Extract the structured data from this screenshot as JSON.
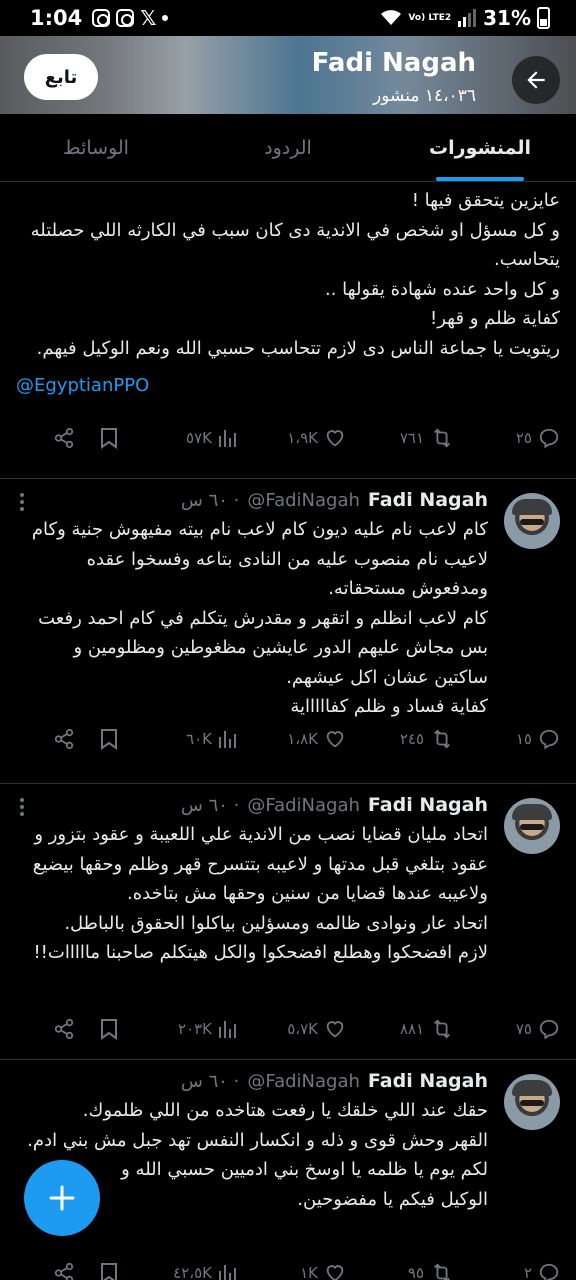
{
  "status_bar": {
    "time": "1:04",
    "lte_label": "Vo) LTE2",
    "battery": "31%"
  },
  "header": {
    "name": "Fadi Nagah",
    "posts_count": "١٤،٠٣٦ منشور",
    "follow_label": "تابع"
  },
  "tabs": [
    {
      "label": "المنشورات",
      "active": true
    },
    {
      "label": "الردود",
      "active": false
    },
    {
      "label": "الوسائط",
      "active": false
    }
  ],
  "posts": [
    {
      "text": "عايزين يتحقق فيها !\nو كل مسؤل او شخص في الاندية دى كان سبب في الكارثه اللي حصلتله يتحاسب.\nو كل واحد عنده شهادة يقولها ..\nكفاية ظلم و قهر!\nريتويت يا جماعة الناس دى لازم تتحاسب حسبي الله ونعم الوكيل فيهم.",
      "link": "@EgyptianPPO",
      "replies": "٢٥",
      "retweets": "٧٦١",
      "likes": "١،٩K",
      "views": "٥٧K"
    },
    {
      "name": "Fadi Nagah",
      "handle": "@FadiNagah",
      "time": "٦٠ س",
      "text": "كام لاعب نام عليه ديون كام لاعب نام بيته مفيهوش جنية وكام لاعيب نام منصوب عليه من النادى بتاعه وفسخوا عقده ومدفعوش مستحقاته.\nكام لاعب انظلم و اتقهر و مقدرش يتكلم في كام احمد رفعت بس مجاش عليهم الدور عايشين مظغوطين ومظلومين و ساكتين عشان اكل عيشهم.\nكفاية فساد و ظلم كفاااااية",
      "replies": "١٥",
      "retweets": "٢٤٥",
      "likes": "١،٨K",
      "views": "٦٠K"
    },
    {
      "name": "Fadi Nagah",
      "handle": "@FadiNagah",
      "time": "٦٠ س",
      "text": "اتحاد مليان قضايا نصب من الاندية علي اللعيبة و عقود بتزور و عقود بتلغي قبل مدتها و لاعيبه بتتسرح قهر وظلم وحقها بيضيع ولاعيبه عندها قضايا من سنين وحقها مش بتاخده.\nاتحاد عار ونوادى ظالمه ومسؤلين بياكلوا الحقوق بالباطل.\nلازم افضحكوا وهطلع افضحكوا والكل هيتكلم صاحبنا مااااات!!",
      "replies": "٧٥",
      "retweets": "٨٨١",
      "likes": "٥،٧K",
      "views": "٢٠٣K"
    },
    {
      "name": "Fadi Nagah",
      "handle": "@FadiNagah",
      "time": "٦٠ س",
      "text": "حقك عند اللي خلقك يا رفعت هتاخده من اللي ظلموك.\nالقهر وحش قوى و ذله و انكسار النفس تهد جبل مش بني ادم.\nلكم يوم يا ظلمه يا اوسخ بني ادميين حسبي الله و\nالوكيل فيكم يا مفضوحين.",
      "replies": "٢",
      "retweets": "٩٥",
      "likes": "١K",
      "views": "٤٢،٥K"
    }
  ],
  "colors": {
    "accent": "#1d9bf0",
    "background": "#000000",
    "muted": "#71767b",
    "text": "#e7e9ea"
  }
}
